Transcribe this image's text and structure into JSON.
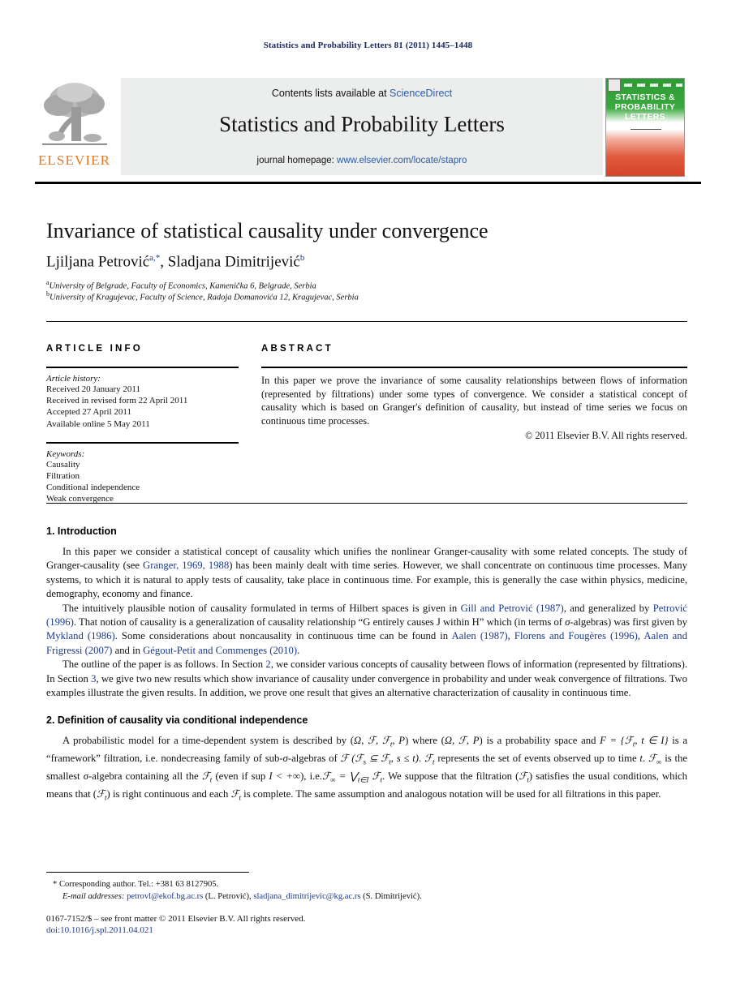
{
  "running_head": "Statistics and Probability Letters 81 (2011) 1445–1448",
  "masthead": {
    "publisher_name": "ELSEVIER",
    "contents_prefix": "Contents lists available at ",
    "contents_link": "ScienceDirect",
    "journal_name": "Statistics and Probability Letters",
    "homepage_prefix": "journal homepage: ",
    "homepage_link": "www.elsevier.com/locate/stapro",
    "cover_title": "STATISTICS & PROBABILITY LETTERS"
  },
  "article": {
    "title": "Invariance of statistical causality under convergence",
    "authors_part1": "Ljiljana Petrović",
    "authors_sup1": "a,",
    "authors_star": "*",
    "authors_sep": ", ",
    "authors_part2": "Sladjana Dimitrijević",
    "authors_sup2": "b",
    "affiliation_a_marker": "a",
    "affiliation_a": "University of Belgrade, Faculty of Economics, Kamenička 6, Belgrade, Serbia",
    "affiliation_b_marker": "b",
    "affiliation_b": "University of Kragujevac, Faculty of Science, Radoja Domanovića 12, Kragujevac, Serbia"
  },
  "info": {
    "heading": "ARTICLE INFO",
    "history_label": "Article history:",
    "history": [
      "Received 20 January 2011",
      "Received in revised form 22 April 2011",
      "Accepted 27 April 2011",
      "Available online 5 May 2011"
    ],
    "keywords_label": "Keywords:",
    "keywords": [
      "Causality",
      "Filtration",
      "Conditional independence",
      "Weak convergence"
    ]
  },
  "abstract": {
    "heading": "ABSTRACT",
    "text": "In this paper we prove the invariance of some causality relationships between flows of information (represented by filtrations) under some types of convergence. We consider a statistical concept of causality which is based on Granger's definition of causality, but instead of time series we focus on continuous time processes.",
    "copyright": "© 2011 Elsevier B.V. All rights reserved."
  },
  "sections": {
    "intro_heading": "1. Introduction",
    "intro_p1_a": "In this paper we consider a statistical concept of causality which unifies the nonlinear Granger-causality with some related concepts. The study of Granger-causality (see ",
    "intro_p1_ref1": "Granger, 1969, 1988",
    "intro_p1_b": ") has been mainly dealt with time series. However, we shall concentrate on continuous time processes. Many systems, to which it is natural to apply tests of causality, take place in continuous time. For example, this is generally the case within physics, medicine, demography, economy and finance.",
    "intro_p2_a": "The intuitively plausible notion of causality formulated in terms of Hilbert spaces is given in ",
    "intro_p2_ref1": "Gill and Petrović (1987)",
    "intro_p2_b": ", and generalized by ",
    "intro_p2_ref2": "Petrović (1996)",
    "intro_p2_c": ". That notion of causality is a generalization of causality relationship “G entirely causes J within H” which (in terms of ",
    "intro_p2_sigma": "σ",
    "intro_p2_d": "-algebras) was first given by ",
    "intro_p2_ref3": "Mykland (1986)",
    "intro_p2_e": ". Some considerations about noncausality in continuous time can be found in ",
    "intro_p2_ref4": "Aalen (1987)",
    "intro_p2_f": ", ",
    "intro_p2_ref5": "Florens and Fougères (1996)",
    "intro_p2_g": ", ",
    "intro_p2_ref6": "Aalen and Frigressi (2007)",
    "intro_p2_h": " and in ",
    "intro_p2_ref7": "Gégout-Petit and Commenges (2010)",
    "intro_p2_i": ".",
    "intro_p3_a": "The outline of the paper is as follows. In Section ",
    "intro_p3_sec2": "2",
    "intro_p3_b": ", we consider various concepts of causality between flows of information (represented by filtrations). In Section ",
    "intro_p3_sec3": "3",
    "intro_p3_c": ", we give two new results which show invariance of causality under convergence in probability and under weak convergence of filtrations. Two examples illustrate the given results. In addition, we prove one result that gives an alternative characterization of causality in continuous time.",
    "def_heading": "2. Definition of causality via conditional independence",
    "def_p1_a": "A probabilistic model for a time-dependent system is described by (",
    "def_p1_b": ") where (",
    "def_p1_c": ") is a probability space and ",
    "def_p1_d": " is a “framework” filtration, i.e. nondecreasing family of sub-",
    "def_p1_e": "-algebras of ",
    "def_p1_f": " represents the set of events observed up to time ",
    "def_p1_g": " is the smallest ",
    "def_p1_h": "-algebra containing all the ",
    "def_p1_i": " (even if sup ",
    "def_p1_j": "), i.e.",
    "def_p1_k": ". We suppose that the filtration (",
    "def_p1_l": ") satisfies the usual conditions, which means that (",
    "def_p1_m": ") is right continuous and each ",
    "def_p1_n": " is complete. The same assumption and analogous notation will be used for all filtrations in this paper."
  },
  "footer": {
    "star": "*",
    "corresponding": "Corresponding author. Tel.: +381 63 8127905.",
    "email_label": "E-mail addresses:",
    "email1": "petrovl@ekof.bg.ac.rs",
    "email1_owner": "(L. Petrović),",
    "email2": "sladjana_dimitrijevic@kg.ac.rs",
    "email2_owner": "(S. Dimitrijević).",
    "issn_line": "0167-7152/$ – see front matter © 2011 Elsevier B.V. All rights reserved.",
    "doi": "doi:10.1016/j.spl.2011.04.021"
  }
}
